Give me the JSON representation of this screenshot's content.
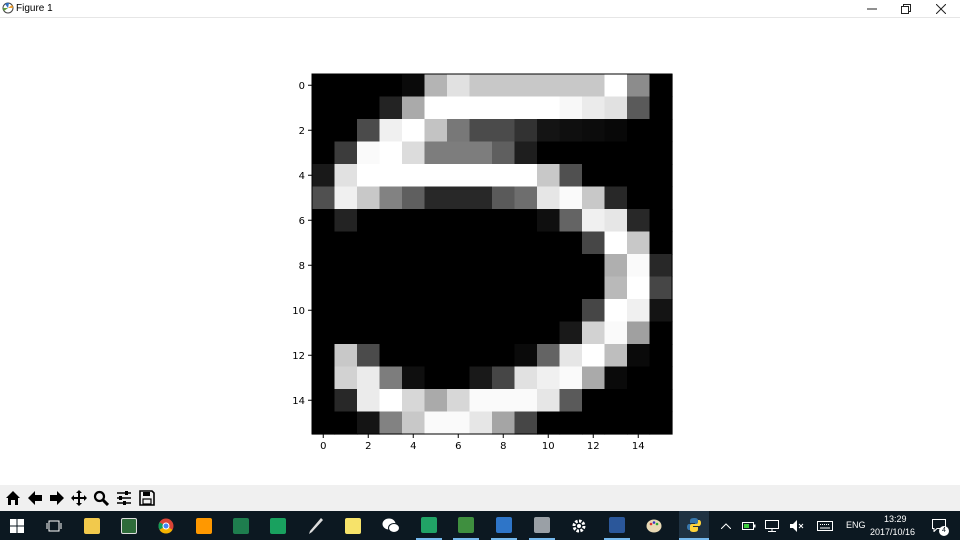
{
  "window": {
    "title": "Figure 1",
    "controls": [
      "minimize",
      "restore",
      "close"
    ]
  },
  "chart_data": {
    "type": "heatmap",
    "colormap": "gray",
    "vmin": 0,
    "vmax": 255,
    "x_ticks": [
      0,
      2,
      4,
      6,
      8,
      10,
      12,
      14
    ],
    "y_ticks": [
      0,
      2,
      4,
      6,
      8,
      10,
      12,
      14
    ],
    "xlim": [
      -0.5,
      15.5
    ],
    "ylim": [
      15.5,
      -0.5
    ],
    "values": [
      [
        0,
        0,
        0,
        0,
        10,
        180,
        225,
        200,
        200,
        200,
        200,
        200,
        200,
        255,
        140,
        0
      ],
      [
        0,
        0,
        0,
        35,
        170,
        255,
        255,
        255,
        255,
        255,
        255,
        248,
        235,
        225,
        90,
        0
      ],
      [
        0,
        0,
        75,
        240,
        255,
        195,
        120,
        75,
        75,
        50,
        20,
        15,
        12,
        8,
        0,
        0
      ],
      [
        0,
        60,
        250,
        255,
        220,
        125,
        125,
        125,
        95,
        30,
        0,
        0,
        0,
        0,
        0,
        0
      ],
      [
        25,
        225,
        255,
        255,
        255,
        255,
        255,
        255,
        255,
        255,
        200,
        80,
        0,
        0,
        0,
        0
      ],
      [
        80,
        240,
        200,
        130,
        95,
        40,
        40,
        40,
        90,
        110,
        230,
        250,
        200,
        40,
        0,
        0
      ],
      [
        0,
        35,
        0,
        0,
        0,
        0,
        0,
        0,
        0,
        0,
        15,
        100,
        240,
        230,
        40,
        0
      ],
      [
        0,
        0,
        0,
        0,
        0,
        0,
        0,
        0,
        0,
        0,
        0,
        0,
        70,
        255,
        200,
        0
      ],
      [
        0,
        0,
        0,
        0,
        0,
        0,
        0,
        0,
        0,
        0,
        0,
        0,
        0,
        175,
        250,
        40
      ],
      [
        0,
        0,
        0,
        0,
        0,
        0,
        0,
        0,
        0,
        0,
        0,
        0,
        0,
        185,
        255,
        70
      ],
      [
        0,
        0,
        0,
        0,
        0,
        0,
        0,
        0,
        0,
        0,
        0,
        0,
        70,
        255,
        240,
        20
      ],
      [
        0,
        0,
        0,
        0,
        0,
        0,
        0,
        0,
        0,
        0,
        0,
        25,
        210,
        250,
        160,
        0
      ],
      [
        0,
        200,
        75,
        0,
        0,
        0,
        0,
        0,
        0,
        10,
        100,
        230,
        255,
        190,
        10,
        0
      ],
      [
        0,
        210,
        235,
        125,
        15,
        0,
        0,
        25,
        70,
        225,
        240,
        250,
        170,
        10,
        0,
        0
      ],
      [
        0,
        40,
        235,
        255,
        215,
        170,
        215,
        250,
        250,
        250,
        230,
        90,
        0,
        0,
        0,
        0
      ],
      [
        0,
        0,
        20,
        130,
        200,
        250,
        250,
        230,
        165,
        70,
        0,
        0,
        0,
        0,
        0,
        0
      ]
    ]
  },
  "toolbar": {
    "buttons": [
      "home-icon",
      "back-icon",
      "forward-icon",
      "pan-icon",
      "zoom-icon",
      "configure-subplots-icon",
      "save-icon"
    ]
  },
  "taskbar": {
    "apps": [
      "start",
      "task-view",
      "file-explorer",
      "terminal",
      "chrome",
      "sublime",
      "app-green",
      "app-s",
      "pen",
      "sticky-notes",
      "wechat",
      "spreadsheet",
      "visual-studio",
      "app-blue",
      "app-gray",
      "settings",
      "document",
      "paint",
      "python"
    ],
    "tray": {
      "language": "ENG",
      "time": "13:29",
      "date": "2017/10/16",
      "notifications": "4"
    },
    "colors": {
      "background": "#0c1821",
      "accent": "#76b9ed"
    }
  }
}
